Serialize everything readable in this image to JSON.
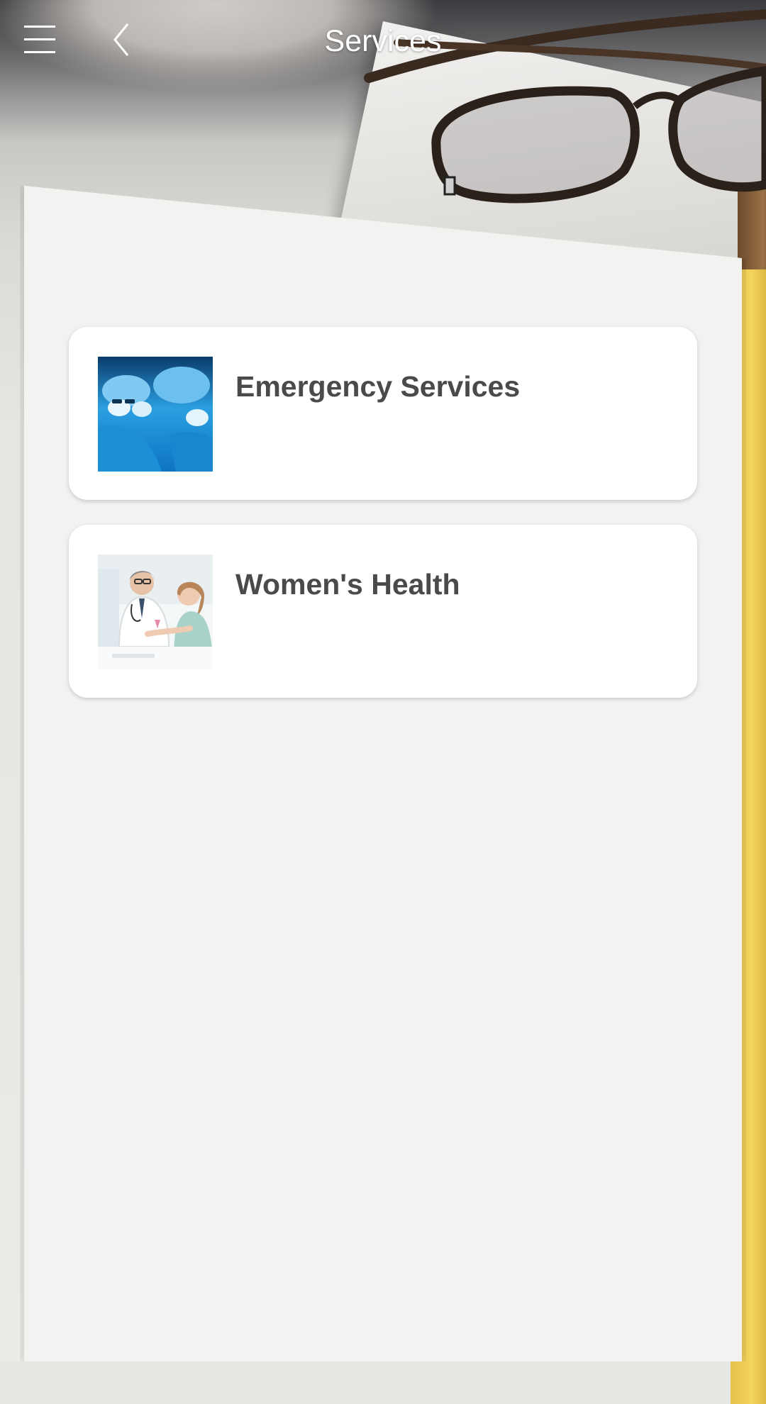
{
  "header": {
    "title": "Services",
    "menu_icon": "hamburger-menu-icon",
    "back_icon": "chevron-left-icon"
  },
  "services": [
    {
      "label": "Emergency Services",
      "image": "surgeons-operating-photo"
    },
    {
      "label": "Women's Health",
      "image": "doctor-patient-consultation-photo"
    }
  ],
  "colors": {
    "title_text": "#ffffff",
    "card_text": "#4a4a4a",
    "panel_bg": "#f2f2f0",
    "card_bg": "#ffffff"
  }
}
